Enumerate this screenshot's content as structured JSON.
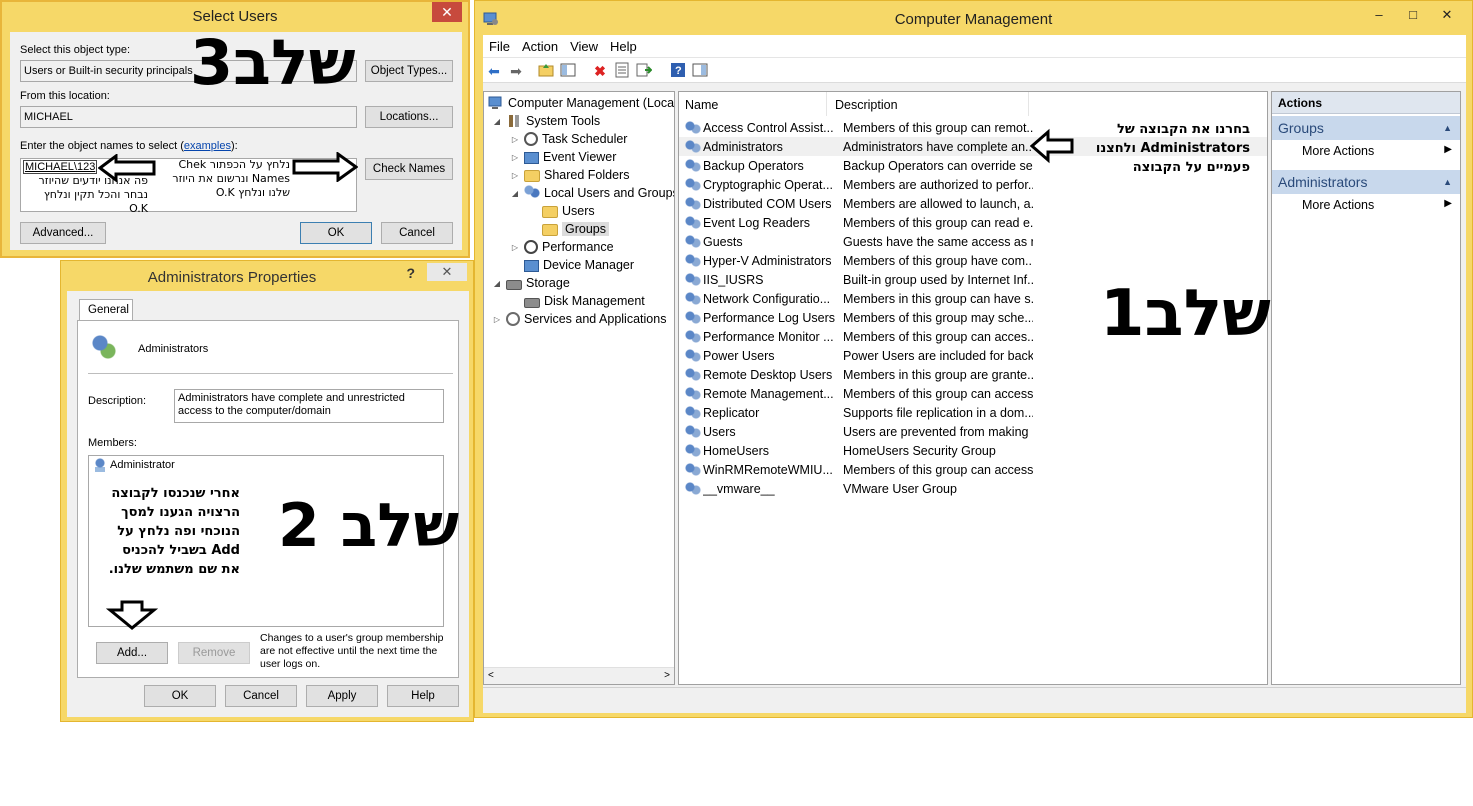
{
  "computer_management": {
    "title": "Computer Management",
    "window_buttons": [
      "–",
      "□",
      "✕"
    ],
    "menu": [
      "File",
      "Action",
      "View",
      "Help"
    ],
    "tree": [
      {
        "label": "Computer Management (Local",
        "level": 0,
        "icon": "computer-icon",
        "arrow": ""
      },
      {
        "label": "System Tools",
        "level": 1,
        "icon": "tools-icon",
        "arrow": "◢"
      },
      {
        "label": "Task Scheduler",
        "level": 2,
        "icon": "clock-icon",
        "arrow": "▷"
      },
      {
        "label": "Event Viewer",
        "level": 2,
        "icon": "event-viewer-icon",
        "arrow": "▷"
      },
      {
        "label": "Shared Folders",
        "level": 2,
        "icon": "shared-folder-icon",
        "arrow": "▷"
      },
      {
        "label": "Local Users and Groups",
        "level": 2,
        "icon": "users-icon",
        "arrow": "◢"
      },
      {
        "label": "Users",
        "level": 3,
        "icon": "folder-icon",
        "arrow": ""
      },
      {
        "label": "Groups",
        "level": 3,
        "icon": "folder-icon",
        "arrow": "",
        "selected": true
      },
      {
        "label": "Performance",
        "level": 2,
        "icon": "performance-icon",
        "arrow": "▷"
      },
      {
        "label": "Device Manager",
        "level": 2,
        "icon": "device-manager-icon",
        "arrow": ""
      },
      {
        "label": "Storage",
        "level": 1,
        "icon": "storage-icon",
        "arrow": "◢"
      },
      {
        "label": "Disk Management",
        "level": 2,
        "icon": "disk-icon",
        "arrow": ""
      },
      {
        "label": "Services and Applications",
        "level": 1,
        "icon": "services-icon",
        "arrow": "▷"
      }
    ],
    "columns": {
      "name": "Name",
      "description": "Description"
    },
    "groups": [
      {
        "name": "Access Control Assist...",
        "description": "Members of this group can remot..."
      },
      {
        "name": "Administrators",
        "description": "Administrators have complete an...",
        "selected": true
      },
      {
        "name": "Backup Operators",
        "description": "Backup Operators can override se..."
      },
      {
        "name": "Cryptographic Operat...",
        "description": "Members are authorized to perfor..."
      },
      {
        "name": "Distributed COM Users",
        "description": "Members are allowed to launch, a..."
      },
      {
        "name": "Event Log Readers",
        "description": "Members of this group can read e..."
      },
      {
        "name": "Guests",
        "description": "Guests have the same access as m..."
      },
      {
        "name": "Hyper-V Administrators",
        "description": "Members of this group have com..."
      },
      {
        "name": "IIS_IUSRS",
        "description": "Built-in group used by Internet Inf..."
      },
      {
        "name": "Network Configuratio...",
        "description": "Members in this group can have s..."
      },
      {
        "name": "Performance Log Users",
        "description": "Members of this group may sche..."
      },
      {
        "name": "Performance Monitor ...",
        "description": "Members of this group can acces..."
      },
      {
        "name": "Power Users",
        "description": "Power Users are included for back..."
      },
      {
        "name": "Remote Desktop Users",
        "description": "Members in this group are grante..."
      },
      {
        "name": "Remote Management...",
        "description": "Members of this group can access..."
      },
      {
        "name": "Replicator",
        "description": "Supports file replication in a dom..."
      },
      {
        "name": "Users",
        "description": "Users are prevented from making ..."
      },
      {
        "name": "HomeUsers",
        "description": "HomeUsers Security Group"
      },
      {
        "name": "WinRMRemoteWMIU...",
        "description": "Members of this group can access..."
      },
      {
        "name": "__vmware__",
        "description": "VMware User Group"
      }
    ],
    "actions": {
      "header": "Actions",
      "section1": {
        "title": "Groups",
        "more": "More Actions"
      },
      "section2": {
        "title": "Administrators",
        "more": "More Actions"
      }
    }
  },
  "select_users": {
    "title": "Select Users",
    "close": "✕",
    "object_type_label": "Select this object type:",
    "object_type_value": "Users or Built-in security principals",
    "object_types_button": "Object Types...",
    "location_label": "From this location:",
    "location_value": "MICHAEL",
    "locations_button": "Locations...",
    "names_label": "Enter the object names to select (",
    "names_label_link": "examples",
    "names_label_end": "):",
    "names_value": "MICHAEL\\123",
    "check_names_button": "Check Names",
    "advanced_button": "Advanced...",
    "ok_button": "OK",
    "cancel_button": "Cancel"
  },
  "admin_properties": {
    "title": "Administrators Properties",
    "help": "?",
    "close": "✕",
    "tab": "General",
    "group_name": "Administrators",
    "description_label": "Description:",
    "description_value": "Administrators have complete and unrestricted access to the computer/domain",
    "members_label": "Members:",
    "members": [
      "Administrator"
    ],
    "add_button": "Add...",
    "remove_button": "Remove",
    "note": "Changes to a user's group membership are not effective until the next time the user logs on.",
    "ok_button": "OK",
    "cancel_button": "Cancel",
    "apply_button": "Apply",
    "help_button": "Help"
  },
  "annotations": {
    "step1": "שלב1",
    "step2": "שלב 2",
    "step3": "שלב3",
    "note1": "בחרנו את הקבוצה של Administrators ולחצנו פעמיים על הקבוצה",
    "note2": "אחרי שנכנסו לקבוצה הרצויה הגענו למסך הנוכחי ופה נלחץ על Add בשביל להכניס את שם משתמש שלנו.",
    "note3a": "פה אנחנו יודעים שהיוזר נבחר והכל תקין ונלחץ O.K",
    "note3b": "נלחץ על הכפתור Chek Names ונרשום את היוזר שלנו ונלחץ O.K"
  }
}
